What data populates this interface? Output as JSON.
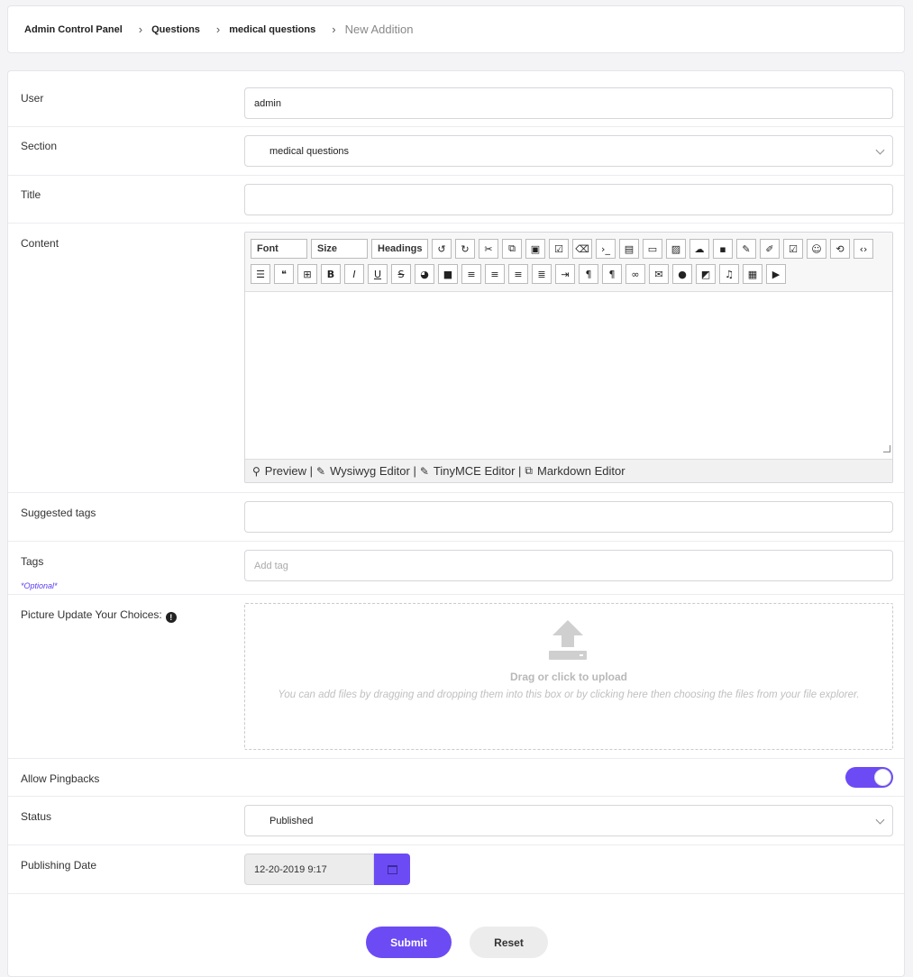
{
  "breadcrumb": {
    "items": [
      "Admin Control Panel",
      "Questions",
      "medical questions"
    ],
    "current": "New Addition",
    "separator": "›"
  },
  "form": {
    "user": {
      "label": "User",
      "value": "admin"
    },
    "section": {
      "label": "Section",
      "value": "medical questions"
    },
    "title": {
      "label": "Title",
      "value": ""
    },
    "content": {
      "label": "Content",
      "toolbar": {
        "font_label": "Font",
        "size_label": "Size",
        "headings_label": "Headings",
        "row1_icons": [
          "undo-icon",
          "redo-icon",
          "cut-icon",
          "copy-icon",
          "paste-icon",
          "paste-text-icon",
          "eraser-icon",
          "code-terminal-icon",
          "file-icon",
          "frame-icon",
          "image-icon",
          "cloud-upload-icon",
          "box-icon",
          "pen-icon",
          "edit-icon",
          "check-edit-icon",
          "smile-icon",
          "history-icon",
          "source-code-icon"
        ],
        "row2_icons": [
          "list-icon",
          "quote-icon",
          "qr-icon",
          "bold-icon",
          "italic-icon",
          "underline-icon",
          "strikethrough-icon",
          "palette-icon",
          "square-icon",
          "align-right-icon",
          "align-center-icon",
          "align-left-icon",
          "justify-icon",
          "indent-icon",
          "ltr-icon",
          "rtl-icon",
          "link-icon",
          "envelope-icon",
          "comment-icon",
          "external-icon",
          "music-icon",
          "television-icon",
          "youtube-icon"
        ]
      },
      "footer": {
        "preview": "Preview |",
        "wysiwyg": "Wysiwyg Editor |",
        "tinymce": "TinyMCE Editor |",
        "markdown": "Markdown Editor"
      }
    },
    "suggested_tags": {
      "label": "Suggested tags",
      "value": ""
    },
    "tags": {
      "label": "Tags",
      "note": "*Optional*",
      "placeholder": "Add tag"
    },
    "picture": {
      "label": "Picture Update Your Choices:",
      "dropzone_title": "Drag or click to upload",
      "dropzone_hint": "You can add files by dragging and dropping them into this box or by clicking here then choosing the files from your file explorer."
    },
    "pingbacks": {
      "label": "Allow Pingbacks",
      "enabled": true
    },
    "status": {
      "label": "Status",
      "value": "Published"
    },
    "publishing_date": {
      "label": "Publishing Date",
      "value": "12-20-2019 9:17"
    },
    "submit_label": "Submit",
    "reset_label": "Reset"
  },
  "colors": {
    "accent": "#6c4bf5"
  }
}
